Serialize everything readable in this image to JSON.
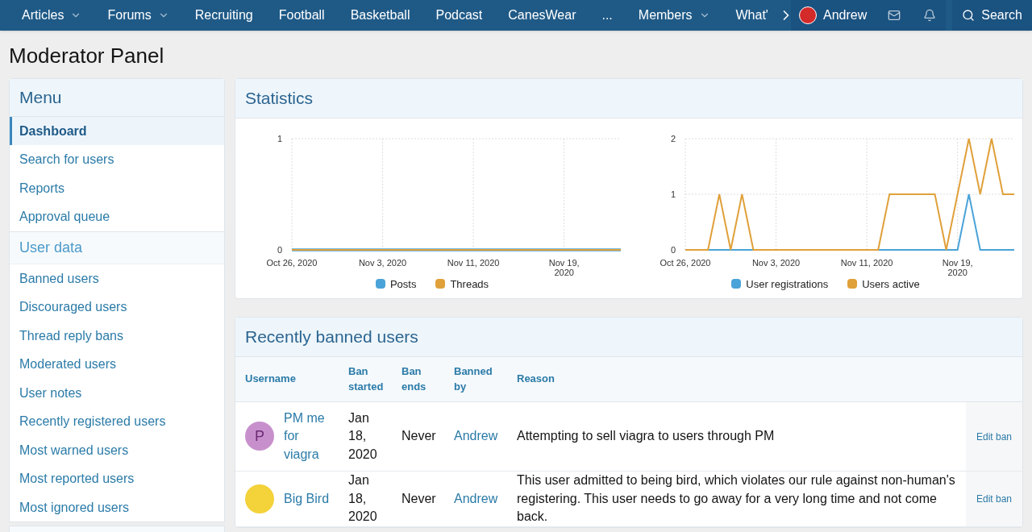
{
  "nav": {
    "items": [
      {
        "label": "Articles",
        "caret": true
      },
      {
        "label": "Forums",
        "caret": true
      },
      {
        "label": "Recruiting",
        "caret": false
      },
      {
        "label": "Football",
        "caret": false
      },
      {
        "label": "Basketball",
        "caret": false
      },
      {
        "label": "Podcast",
        "caret": false
      },
      {
        "label": "CanesWear",
        "caret": false
      },
      {
        "label": "...",
        "caret": false
      },
      {
        "label": "Members",
        "caret": true
      },
      {
        "label": "What'",
        "caret": false
      }
    ],
    "user": "Andrew",
    "search": "Search"
  },
  "page_title": "Moderator Panel",
  "sidebar": {
    "sections": [
      {
        "title": "Menu",
        "kind": "main",
        "items": [
          {
            "label": "Dashboard",
            "selected": true
          },
          {
            "label": "Search for users",
            "selected": false
          },
          {
            "label": "Reports",
            "selected": false
          },
          {
            "label": "Approval queue",
            "selected": false
          }
        ]
      },
      {
        "title": "User data",
        "kind": "sub",
        "items": [
          {
            "label": "Banned users",
            "selected": false
          },
          {
            "label": "Discouraged users",
            "selected": false
          },
          {
            "label": "Thread reply bans",
            "selected": false
          },
          {
            "label": "Moderated users",
            "selected": false
          },
          {
            "label": "User notes",
            "selected": false
          },
          {
            "label": "Recently registered users",
            "selected": false
          },
          {
            "label": "Most warned users",
            "selected": false
          },
          {
            "label": "Most reported users",
            "selected": false
          },
          {
            "label": "Most ignored users",
            "selected": false
          }
        ]
      }
    ]
  },
  "statistics": {
    "title": "Statistics",
    "charts": [
      {
        "chart_data": {
          "type": "line",
          "categories": [
            "Oct 26, 2020",
            null,
            null,
            null,
            null,
            null,
            null,
            null,
            "Nov 3, 2020",
            null,
            null,
            null,
            null,
            null,
            null,
            null,
            "Nov 11, 2020",
            null,
            null,
            null,
            null,
            null,
            null,
            null,
            "Nov 19, 2020",
            null,
            null,
            null,
            null,
            null
          ],
          "ylim": [
            0,
            1
          ],
          "yticks": [
            0,
            1
          ],
          "grid": true,
          "legend": "bottom",
          "series": [
            {
              "name": "Posts",
              "color": "#4aa3d8",
              "values": [
                0,
                0,
                0,
                0,
                0,
                0,
                0,
                0,
                0,
                0,
                0,
                0,
                0,
                0,
                0,
                0,
                0,
                0,
                0,
                0,
                0,
                0,
                0,
                0,
                0,
                0,
                0,
                0,
                0,
                0
              ]
            },
            {
              "name": "Threads",
              "color": "#e0a03a",
              "values": [
                0,
                0,
                0,
                0,
                0,
                0,
                0,
                0,
                0,
                0,
                0,
                0,
                0,
                0,
                0,
                0,
                0,
                0,
                0,
                0,
                0,
                0,
                0,
                0,
                0,
                0,
                0,
                0,
                0,
                0
              ]
            }
          ]
        }
      },
      {
        "chart_data": {
          "type": "line",
          "categories": [
            "Oct 26, 2020",
            null,
            null,
            null,
            null,
            null,
            null,
            null,
            "Nov 3, 2020",
            null,
            null,
            null,
            null,
            null,
            null,
            null,
            "Nov 11, 2020",
            null,
            null,
            null,
            null,
            null,
            null,
            null,
            "Nov 19, 2020",
            null,
            null,
            null,
            null,
            null
          ],
          "ylim": [
            0,
            2
          ],
          "yticks": [
            0,
            1,
            2
          ],
          "grid": true,
          "legend": "bottom",
          "series": [
            {
              "name": "User registrations",
              "color": "#4aa3d8",
              "values": [
                0,
                0,
                0,
                0,
                0,
                0,
                0,
                0,
                0,
                0,
                0,
                0,
                0,
                0,
                0,
                0,
                0,
                0,
                0,
                0,
                0,
                0,
                0,
                0,
                0,
                1,
                0,
                0,
                0,
                0
              ]
            },
            {
              "name": "Users active",
              "color": "#e0a03a",
              "values": [
                0,
                0,
                0,
                1,
                0,
                1,
                0,
                0,
                0,
                0,
                0,
                0,
                0,
                0,
                0,
                0,
                0,
                0,
                1,
                1,
                1,
                1,
                1,
                0,
                1,
                2,
                1,
                2,
                1,
                1
              ]
            }
          ]
        }
      }
    ]
  },
  "banned": {
    "title": "Recently banned users",
    "columns": [
      "Username",
      "Ban started",
      "Ban ends",
      "Banned by",
      "Reason"
    ],
    "rows": [
      {
        "avatar": {
          "kind": "letter",
          "letter": "P"
        },
        "username": "PM me for viagra",
        "started": "Jan 18, 2020",
        "ends": "Never",
        "by": "Andrew",
        "reason": "Attempting to sell viagra to users through PM",
        "action": "Edit ban"
      },
      {
        "avatar": {
          "kind": "image"
        },
        "username": "Big Bird",
        "started": "Jan 18, 2020",
        "ends": "Never",
        "by": "Andrew",
        "reason": "This user admitted to being bird, which violates our rule against non-human's registering. This user needs to go away for a very long time and not come back.",
        "action": "Edit ban"
      }
    ]
  }
}
